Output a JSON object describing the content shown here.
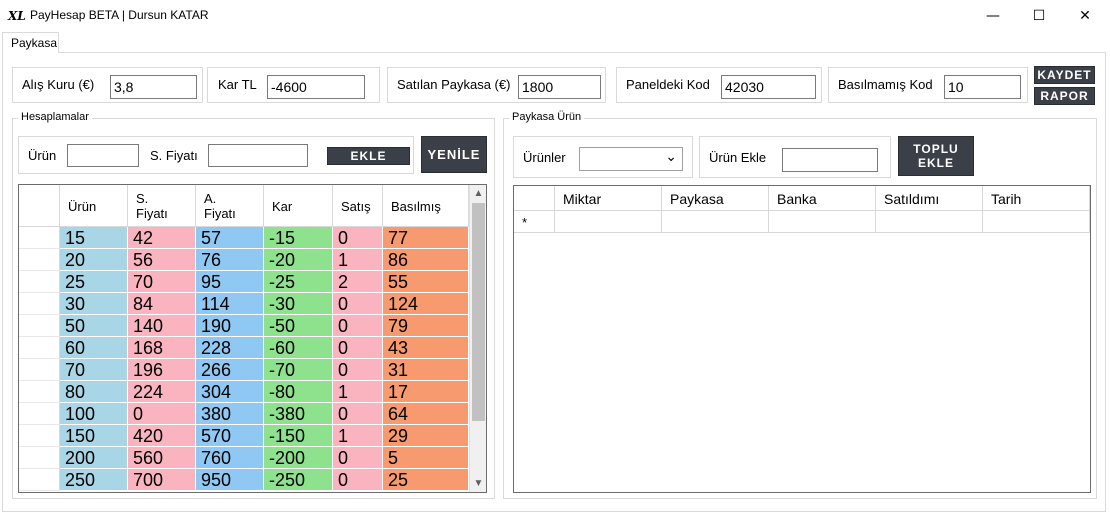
{
  "window": {
    "title": "PayHesap BETA | Dursun KATAR",
    "icon_text": "XL",
    "min_glyph": "—",
    "max_glyph": "☐",
    "close_glyph": "✕"
  },
  "tabs": [
    {
      "label": "Paykasa"
    }
  ],
  "top": {
    "alis_kuru": {
      "label": "Alış Kuru (€)",
      "value": "3,8"
    },
    "kar_tl": {
      "label": "Kar TL",
      "value": "-4600"
    },
    "satilan": {
      "label": "Satılan Paykasa (€)",
      "value": "1800"
    },
    "paneldeki": {
      "label": "Paneldeki Kod",
      "value": "42030"
    },
    "basilmamis": {
      "label": "Basılmamış Kod",
      "value": "10"
    },
    "kaydet_label": "KAYDET",
    "rapor_label": "RAPOR"
  },
  "hesaplamalar": {
    "title": "Hesaplamalar",
    "urun_label": "Ürün",
    "urun_value": "",
    "sfiyati_label": "S. Fiyatı",
    "sfiyati_value": "",
    "ekle_label": "EKLE",
    "yenile_label": "YENİLE",
    "columns": [
      "Ürün",
      "S.\nFiyatı",
      "A.\nFiyatı",
      "Kar",
      "Satış",
      "Basılmış"
    ],
    "rows": [
      [
        "15",
        "42",
        "57",
        "-15",
        "0",
        "77"
      ],
      [
        "20",
        "56",
        "76",
        "-20",
        "1",
        "86"
      ],
      [
        "25",
        "70",
        "95",
        "-25",
        "2",
        "55"
      ],
      [
        "30",
        "84",
        "114",
        "-30",
        "0",
        "124"
      ],
      [
        "50",
        "140",
        "190",
        "-50",
        "0",
        "79"
      ],
      [
        "60",
        "168",
        "228",
        "-60",
        "0",
        "43"
      ],
      [
        "70",
        "196",
        "266",
        "-70",
        "0",
        "31"
      ],
      [
        "80",
        "224",
        "304",
        "-80",
        "1",
        "17"
      ],
      [
        "100",
        "0",
        "380",
        "-380",
        "0",
        "64"
      ],
      [
        "150",
        "420",
        "570",
        "-150",
        "1",
        "29"
      ],
      [
        "200",
        "560",
        "760",
        "-200",
        "0",
        "5"
      ],
      [
        "250",
        "700",
        "950",
        "-250",
        "0",
        "25"
      ]
    ],
    "scroll_up": "▲",
    "scroll_down": "▼"
  },
  "paykasa_urun": {
    "title": "Paykasa Ürün",
    "urunler_label": "Ürünler",
    "urunler_value": "",
    "chevron": "⌄",
    "urun_ekle_label": "Ürün Ekle",
    "urun_ekle_value": "",
    "toplu_ekle_line1": "TOPLU",
    "toplu_ekle_line2": "EKLE",
    "columns": [
      "Miktar",
      "Paykasa",
      "Banka",
      "Satıldımı",
      "Tarih"
    ],
    "new_row_marker": "*"
  },
  "colors": {
    "urun": "#a9d6e6",
    "s_fiyati": "#f9b4c0",
    "a_fiyati": "#8fc8f2",
    "kar": "#8ee28e",
    "satis": "#f9b4c0",
    "basilmis": "#f79a6f",
    "dark_button": "#3b4048"
  }
}
